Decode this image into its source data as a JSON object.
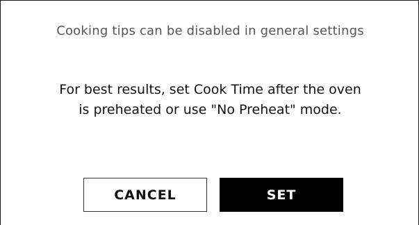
{
  "dialog": {
    "tip_note": "Cooking tips can be disabled in general settings",
    "message": "For best results, set Cook Time after the oven is preheated or use \"No Preheat\" mode.",
    "buttons": {
      "cancel_label": "CANCEL",
      "set_label": "SET"
    }
  },
  "colors": {
    "primary_button_bg": "#000000",
    "primary_button_text": "#ffffff",
    "secondary_button_border": "#333333",
    "note_text": "#555555"
  }
}
